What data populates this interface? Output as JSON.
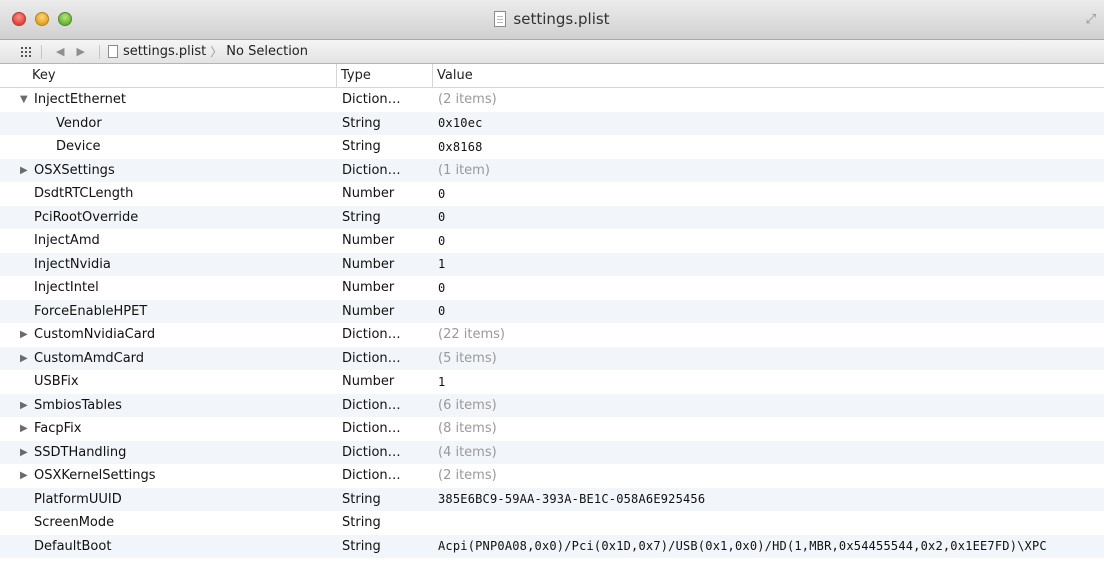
{
  "window": {
    "title": "settings.plist",
    "fullscreen_icon": "fullscreen-arrows-icon"
  },
  "jumpbar": {
    "file": "settings.plist",
    "selection": "No Selection"
  },
  "columns": {
    "key": "Key",
    "type": "Type",
    "value": "Value"
  },
  "rows": [
    {
      "key": "InjectEthernet",
      "type": "Diction…",
      "value": "(2 items)",
      "expander": "expanded"
    },
    {
      "key": "Vendor",
      "type": "String",
      "value": "0x10ec",
      "child": true
    },
    {
      "key": "Device",
      "type": "String",
      "value": "0x8168",
      "child": true
    },
    {
      "key": "OSXSettings",
      "type": "Diction…",
      "value": "(1 item)",
      "expander": "collapsed"
    },
    {
      "key": "DsdtRTCLength",
      "type": "Number",
      "value": "0"
    },
    {
      "key": "PciRootOverride",
      "type": "String",
      "value": "0"
    },
    {
      "key": "InjectAmd",
      "type": "Number",
      "value": "0"
    },
    {
      "key": "InjectNvidia",
      "type": "Number",
      "value": "1"
    },
    {
      "key": "InjectIntel",
      "type": "Number",
      "value": "0"
    },
    {
      "key": "ForceEnableHPET",
      "type": "Number",
      "value": "0"
    },
    {
      "key": "CustomNvidiaCard",
      "type": "Diction…",
      "value": "(22 items)",
      "expander": "collapsed"
    },
    {
      "key": "CustomAmdCard",
      "type": "Diction…",
      "value": "(5 items)",
      "expander": "collapsed"
    },
    {
      "key": "USBFix",
      "type": "Number",
      "value": "1"
    },
    {
      "key": "SmbiosTables",
      "type": "Diction…",
      "value": "(6 items)",
      "expander": "collapsed"
    },
    {
      "key": "FacpFix",
      "type": "Diction…",
      "value": "(8 items)",
      "expander": "collapsed"
    },
    {
      "key": "SSDTHandling",
      "type": "Diction…",
      "value": "(4 items)",
      "expander": "collapsed"
    },
    {
      "key": "OSXKernelSettings",
      "type": "Diction…",
      "value": "(2 items)",
      "expander": "collapsed"
    },
    {
      "key": "PlatformUUID",
      "type": "String",
      "value": "385E6BC9-59AA-393A-BE1C-058A6E925456"
    },
    {
      "key": "ScreenMode",
      "type": "String",
      "value": ""
    },
    {
      "key": "DefaultBoot",
      "type": "String",
      "value": "Acpi(PNP0A08,0x0)/Pci(0x1D,0x7)/USB(0x1,0x0)/HD(1,MBR,0x54455544,0x2,0x1EE7FD)\\XPC"
    }
  ]
}
